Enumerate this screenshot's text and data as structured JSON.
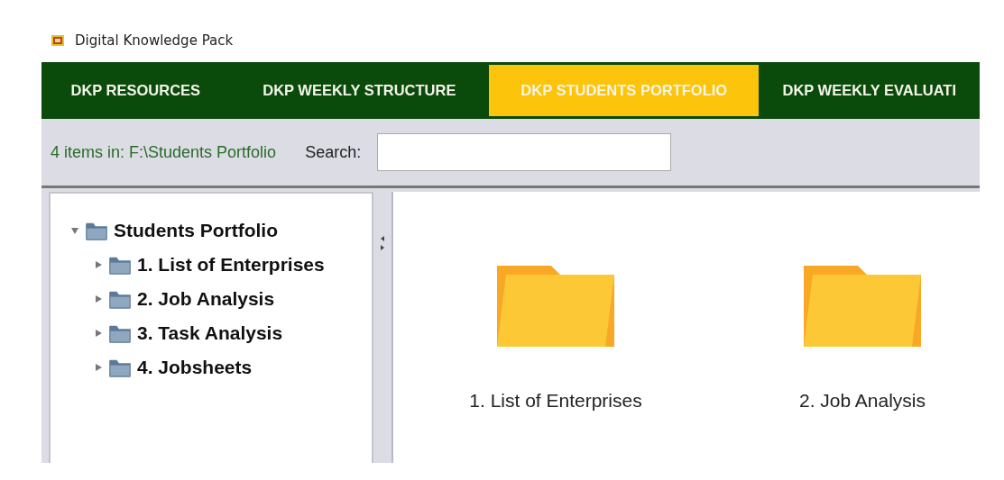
{
  "window": {
    "title": "Digital Knowledge Pack"
  },
  "tabs": [
    {
      "label": "DKP RESOURCES",
      "selected": false
    },
    {
      "label": "DKP WEEKLY STRUCTURE",
      "selected": false
    },
    {
      "label": "DKP STUDENTS PORTFOLIO",
      "selected": true
    },
    {
      "label": "DKP WEEKLY EVALUATI",
      "selected": false
    }
  ],
  "toolbar": {
    "status": "4 items in: F:\\Students Portfolio",
    "search_label": "Search:"
  },
  "tree": {
    "label": "Students Portfolio",
    "expanded": true,
    "children": [
      {
        "label": "1. List of Enterprises",
        "expanded": false
      },
      {
        "label": "2. Job Analysis",
        "expanded": false
      },
      {
        "label": "3. Task Analysis",
        "expanded": false
      },
      {
        "label": "4. Jobsheets",
        "expanded": false
      }
    ]
  },
  "files": [
    {
      "label": "1. List of Enterprises"
    },
    {
      "label": "2. Job Analysis"
    }
  ]
}
